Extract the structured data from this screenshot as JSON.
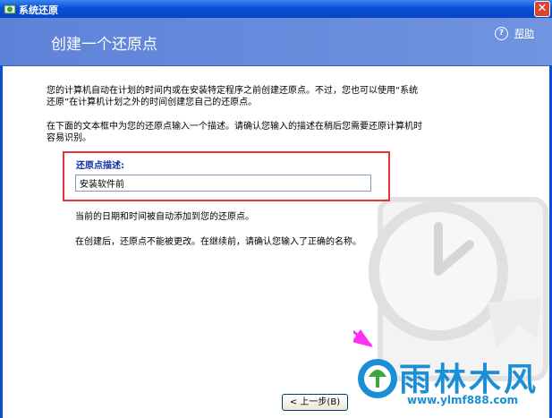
{
  "window": {
    "title": "系统还原",
    "close_symbol": "✕"
  },
  "header": {
    "title": "创建一个还原点",
    "help_label": "帮助",
    "help_symbol": "?"
  },
  "body": {
    "paragraph1": "您的计算机自动在计划的时间内或在安装特定程序之前创建还原点。不过，您也可以使用“系统还原”在计算机计划之外的时间创建您自己的还原点。",
    "paragraph2": "在下面的文本框中为您的还原点输入一个描述。请确认您输入的描述在稍后您需要还原计算机时容易识别。",
    "field_label": "还原点描述:",
    "field_value": "安装软件前",
    "note1": "当前的日期和时间被自动添加到您的还原点。",
    "note2": "在创建后，还原点不能被更改。在继续前，请确认您输入了正确的名称。"
  },
  "buttons": {
    "back": "< 上一步(B)"
  },
  "watermark_logo": {
    "name": "雨林木风",
    "url": "www.ylmf888.com"
  },
  "colors": {
    "titlebar": "#0a4fd6",
    "header": "#6487dc",
    "highlight_border": "#e8323a",
    "logo": "#1a8fd6"
  }
}
